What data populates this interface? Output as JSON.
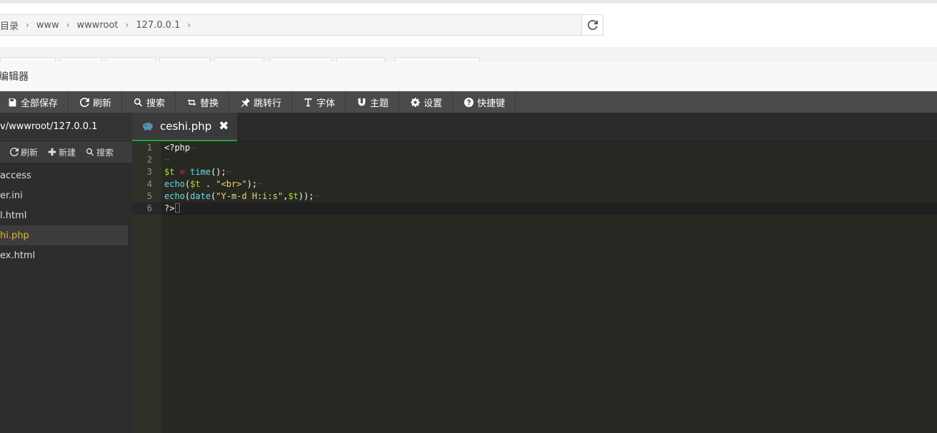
{
  "breadcrumb": {
    "items": [
      "目录",
      "www",
      "wwwroot",
      "127.0.0.1"
    ]
  },
  "editor": {
    "title": "编辑器",
    "toolbar": [
      {
        "label": "全部保存",
        "icon": "save-icon"
      },
      {
        "label": "刷新",
        "icon": "refresh-icon"
      },
      {
        "label": "搜索",
        "icon": "search-icon"
      },
      {
        "label": "替换",
        "icon": "replace-icon"
      },
      {
        "label": "跳转行",
        "icon": "pin-icon"
      },
      {
        "label": "字体",
        "icon": "font-icon"
      },
      {
        "label": "主题",
        "icon": "magnet-icon"
      },
      {
        "label": "设置",
        "icon": "gear-icon"
      },
      {
        "label": "快捷键",
        "icon": "help-icon"
      }
    ],
    "sidebar": {
      "path": "v/wwwroot/127.0.0.1",
      "actions": [
        "刷新",
        "新建",
        "搜索"
      ],
      "files": [
        "access",
        "er.ini",
        "l.html",
        "hi.php",
        "ex.html"
      ],
      "active_index": 3
    },
    "tab": {
      "filename": "ceshi.php"
    },
    "code": {
      "line_numbers": [
        "1",
        "2",
        "3",
        "4",
        "5",
        "6"
      ],
      "current_line": 6,
      "lines": [
        "<?php",
        "",
        "$t = time();",
        "echo($t . \"<br>\");",
        "echo(date(\"Y-m-d H:i:s\",$t));",
        "?>"
      ]
    }
  },
  "colors": {
    "accent_green": "#20a53a",
    "active_file": "#e6b422",
    "editor_bg": "#272822"
  }
}
